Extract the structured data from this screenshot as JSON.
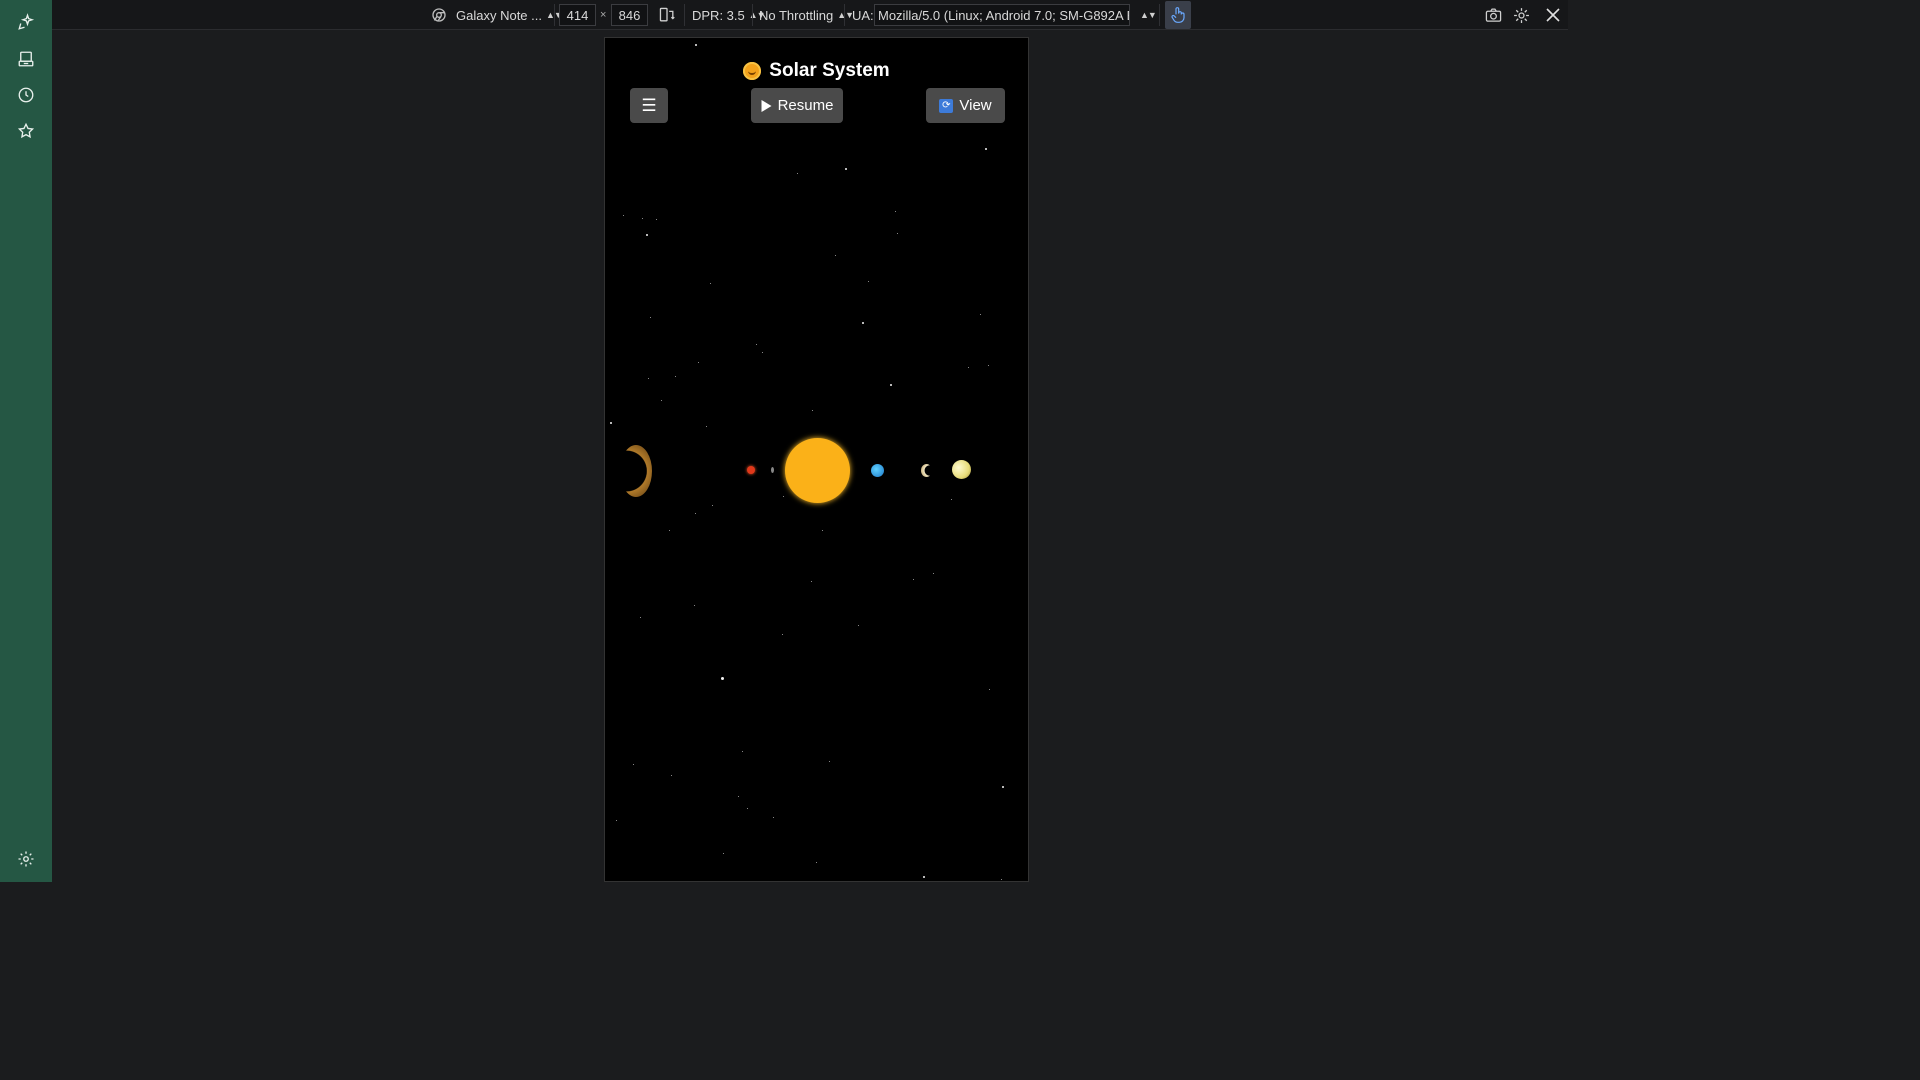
{
  "devtools": {
    "device_name": "Galaxy Note ...",
    "width_value": "414",
    "times_symbol": "×",
    "height_value": "846",
    "dpr_label": "DPR: 3.5",
    "throttling_label": "No Throttling",
    "ua_label": "UA:",
    "ua_value": "Mozilla/5.0 (Linux; Android 7.0; SM-G892A Bui",
    "accent_color": "#255744"
  },
  "sidebar": {
    "icons": [
      "sparkle-icon",
      "device-icon",
      "history-icon",
      "star-icon",
      "settings-icon"
    ]
  },
  "app": {
    "title": "Solar System",
    "menu_label": "☰",
    "resume_label": "Resume",
    "view_label": "View"
  }
}
